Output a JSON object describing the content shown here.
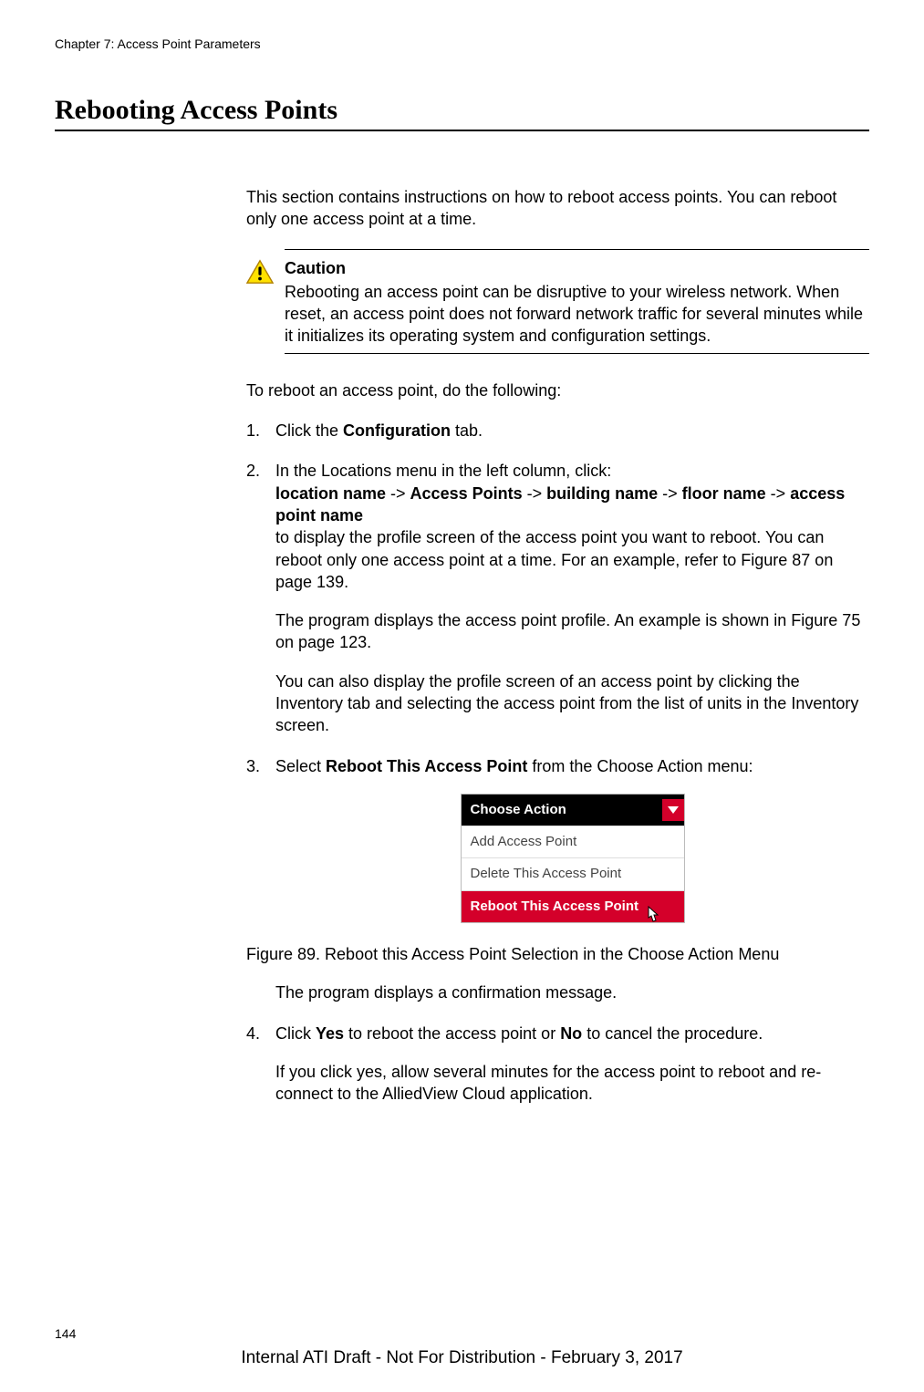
{
  "chapter_header": "Chapter 7: Access Point Parameters",
  "section_title": "Rebooting Access Points",
  "intro": "This section contains instructions on how to reboot access points. You can reboot only one access point at a time.",
  "caution": {
    "label": "Caution",
    "text": "Rebooting an access point can be disruptive to your wireless network. When reset, an access point does not forward network traffic for several minutes while it initializes its operating system and configuration settings."
  },
  "lead_in": "To reboot an access point, do the following:",
  "steps": {
    "s1_a": "Click the ",
    "s1_b": "Configuration",
    "s1_c": " tab.",
    "s2_line1": "In the Locations menu in the left column, click:",
    "s2_loc": "location name",
    "s2_ap": "Access Points",
    "s2_bldg": "building name",
    "s2_floor": "floor name",
    "s2_apname": "access point name",
    "s2_arrow": " -> ",
    "s2_rest": "to display the profile screen of the access point you want to reboot. You can reboot only one access point at a time. For an example, refer to Figure 87 on page 139.",
    "s2_profile": "The program displays the access point profile. An example is shown in Figure 75 on page 123.",
    "s2_inventory": "You can also display the profile screen of an access point by clicking the Inventory tab and selecting the access point from the list of units in the Inventory screen.",
    "s3_a": "Select ",
    "s3_b": "Reboot This Access Point",
    "s3_c": " from the Choose Action menu:",
    "s3_confirm": "The program displays a confirmation message.",
    "s4_a": "Click ",
    "s4_yes": "Yes",
    "s4_mid": " to reboot the access point or ",
    "s4_no": "No",
    "s4_end": " to cancel the procedure.",
    "s4_wait": "If you click yes, allow several minutes for the access point to reboot and re-connect to the AlliedView Cloud application."
  },
  "menu": {
    "header": "Choose Action",
    "item1": "Add Access Point",
    "item2": "Delete This Access Point",
    "item3": "Reboot This Access Point"
  },
  "figure_caption": "Figure 89. Reboot this Access Point Selection in the Choose Action Menu",
  "page_number": "144",
  "footer": "Internal ATI Draft - Not For Distribution - February 3, 2017"
}
